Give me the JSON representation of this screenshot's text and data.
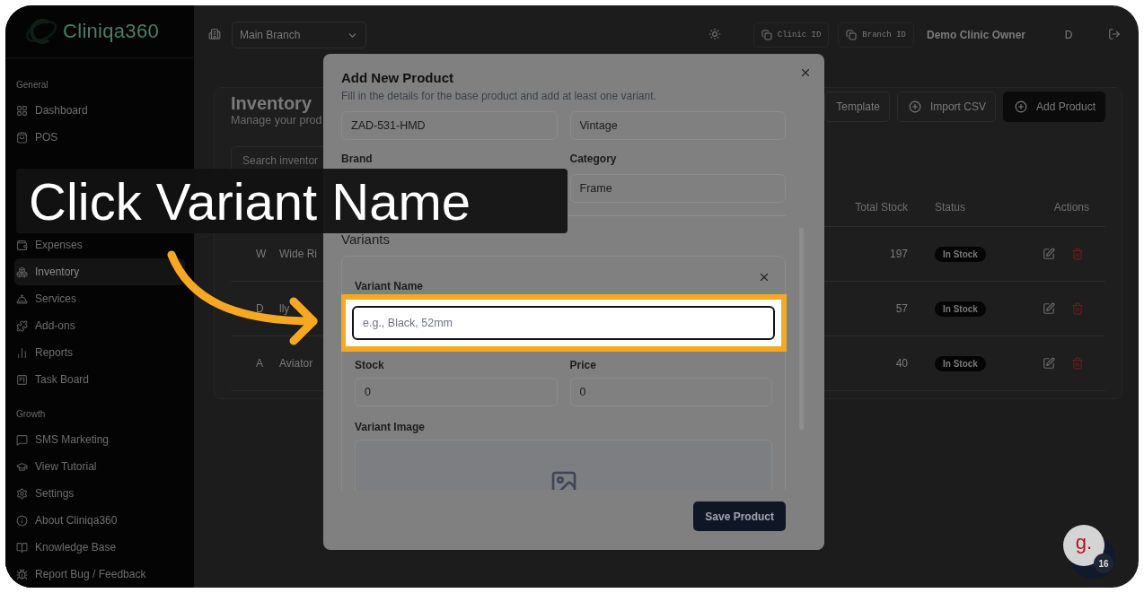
{
  "sidebar": {
    "logo": "Cliniqa360",
    "groups": [
      {
        "title": "General",
        "items": [
          {
            "label": "Dashboard",
            "selected": false
          },
          {
            "label": "POS",
            "selected": false
          }
        ]
      },
      {
        "items": [
          {
            "label": "Expenses",
            "selected": false
          },
          {
            "label": "Inventory",
            "selected": true
          },
          {
            "label": "Services",
            "selected": false
          },
          {
            "label": "Add-ons",
            "selected": false
          },
          {
            "label": "Reports",
            "selected": false
          },
          {
            "label": "Task Board",
            "selected": false
          }
        ]
      },
      {
        "title": "Growth",
        "items": [
          {
            "label": "SMS Marketing",
            "selected": false
          }
        ]
      }
    ],
    "footer_items": [
      "View Tutorial",
      "Settings",
      "About Cliniqa360",
      "Knowledge Base",
      "Report Bug / Feedback"
    ]
  },
  "header": {
    "branch": "Main Branch",
    "clinic_id": "Clinic ID",
    "branch_id": "Branch ID",
    "user": "Demo Clinic Owner",
    "avatar": "D"
  },
  "inventory": {
    "title": "Inventory",
    "subtitle": "Manage your prod",
    "buttons": [
      {
        "label": "Template",
        "kind": "outline"
      },
      {
        "label": "Import CSV",
        "kind": "outline"
      },
      {
        "label": "Add Product",
        "kind": "primary"
      }
    ],
    "search": {
      "placeholder": "Search inventor"
    },
    "table": {
      "columns": [
        "Total Stock",
        "Status",
        "Actions"
      ],
      "rows": [
        {
          "initial": "W",
          "name": "Wide Ri",
          "total_stock": "197",
          "status": "In Stock"
        },
        {
          "initial": "D",
          "name": "lly",
          "total_stock": "57",
          "status": "In Stock"
        },
        {
          "initial": "A",
          "name": "Aviator",
          "total_stock": "40",
          "status": "In Stock"
        }
      ]
    }
  },
  "modal": {
    "title": "Add New Product",
    "subtitle": "Fill in the details for the base product and add at least one variant.",
    "top_values": [
      "ZAD-531-HMD",
      "Vintage"
    ],
    "fields": [
      {
        "label": "Brand"
      },
      {
        "label": "Category",
        "value": "Frame"
      }
    ],
    "variants_title": "Variants",
    "variant": {
      "name_label": "Variant Name",
      "name_placeholder": "e.g., Black, 52mm",
      "stock_label": "Stock",
      "stock_value": "0",
      "price_label": "Price",
      "price_value": "0",
      "image_label": "Variant Image"
    },
    "save_button": "Save Product"
  },
  "tutorial": {
    "callout": "Click Variant Name"
  },
  "widget": {
    "logo": "g.",
    "badge": "16"
  }
}
